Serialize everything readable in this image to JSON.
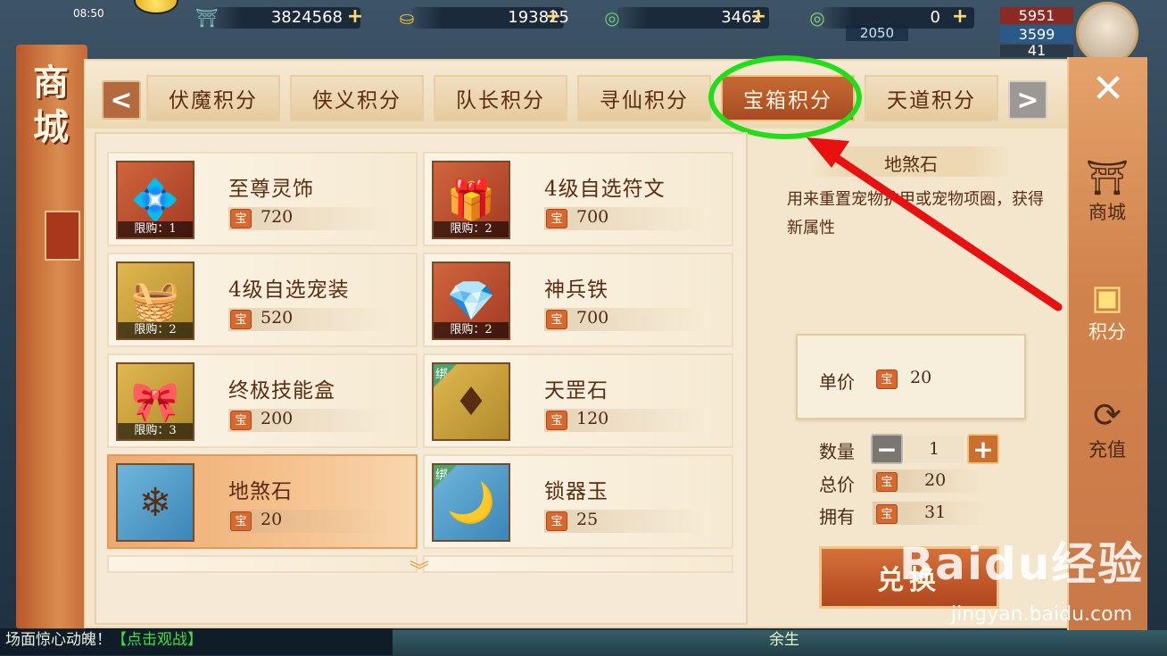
{
  "status": {
    "time": "08:50"
  },
  "resources": [
    {
      "icon": "jade-tower-icon",
      "value": "3824568",
      "plus": "+"
    },
    {
      "icon": "gold-ingot-icon",
      "value": "193825",
      "plus": "+"
    },
    {
      "icon": "bound-jade-icon",
      "value": "3462",
      "plus": "+"
    },
    {
      "icon": "jade-icon",
      "value": "0",
      "plus": "+"
    }
  ],
  "player_stats": [
    "5951",
    "3599",
    "41"
  ],
  "background_value": "2050",
  "shop": {
    "side_title": "商城",
    "tabs": [
      {
        "label": "伏魔积分",
        "active": false
      },
      {
        "label": "侠义积分",
        "active": false
      },
      {
        "label": "队长积分",
        "active": false
      },
      {
        "label": "寻仙积分",
        "active": false
      },
      {
        "label": "宝箱积分",
        "active": true
      },
      {
        "label": "天道积分",
        "active": false
      }
    ],
    "prev_label": "<",
    "next_label": ">",
    "currency_glyph": "宝",
    "items": [
      {
        "name": "至尊灵饰",
        "price": "720",
        "limit": "限购：1",
        "bind": "",
        "icon": "ornament-icon",
        "color": "#c8503a"
      },
      {
        "name": "4级自选符文",
        "price": "700",
        "limit": "限购：2",
        "bind": "",
        "icon": "treasure-chest-icon",
        "color": "#c8503a"
      },
      {
        "name": "4级自选宠装",
        "price": "520",
        "limit": "限购：2",
        "bind": "",
        "icon": "pet-armor-box-icon",
        "color": "#c8a84a"
      },
      {
        "name": "神兵铁",
        "price": "700",
        "limit": "限购：2",
        "bind": "",
        "icon": "crystal-ore-icon",
        "color": "#c8503a"
      },
      {
        "name": "终极技能盒",
        "price": "200",
        "limit": "限购：3",
        "bind": "",
        "icon": "skill-box-icon",
        "color": "#c8a84a"
      },
      {
        "name": "天罡石",
        "price": "120",
        "limit": "",
        "bind": "绑",
        "icon": "red-gem-icon",
        "color": "#c8a84a"
      },
      {
        "name": "地煞石",
        "price": "20",
        "limit": "",
        "bind": "",
        "icon": "blue-crystal-icon",
        "color": "#4a9ac8",
        "selected": true
      },
      {
        "name": "锁器玉",
        "price": "25",
        "limit": "",
        "bind": "绑",
        "icon": "golden-jade-icon",
        "color": "#4a9ac8"
      }
    ]
  },
  "detail": {
    "title": "地煞石",
    "description": "用来重置宠物护甲或宠物项圈，获得新属性",
    "unit_price_label": "单价",
    "unit_price": "20",
    "quantity_label": "数量",
    "quantity": "1",
    "total_label": "总价",
    "total": "20",
    "owned_label": "拥有",
    "owned": "31",
    "buy_label": "兑换"
  },
  "rail": [
    {
      "label": "商城",
      "icon": "shop-building-icon"
    },
    {
      "label": "积分",
      "icon": "points-chest-icon"
    },
    {
      "label": "充值",
      "icon": "dragon-recharge-icon"
    }
  ],
  "chat": {
    "text": "场面惊心动魄！",
    "link": "【点击观战】"
  },
  "bottom_label": "余生",
  "watermark": {
    "main": "Baidu经验",
    "sub": "jingyan.baidu.com"
  }
}
